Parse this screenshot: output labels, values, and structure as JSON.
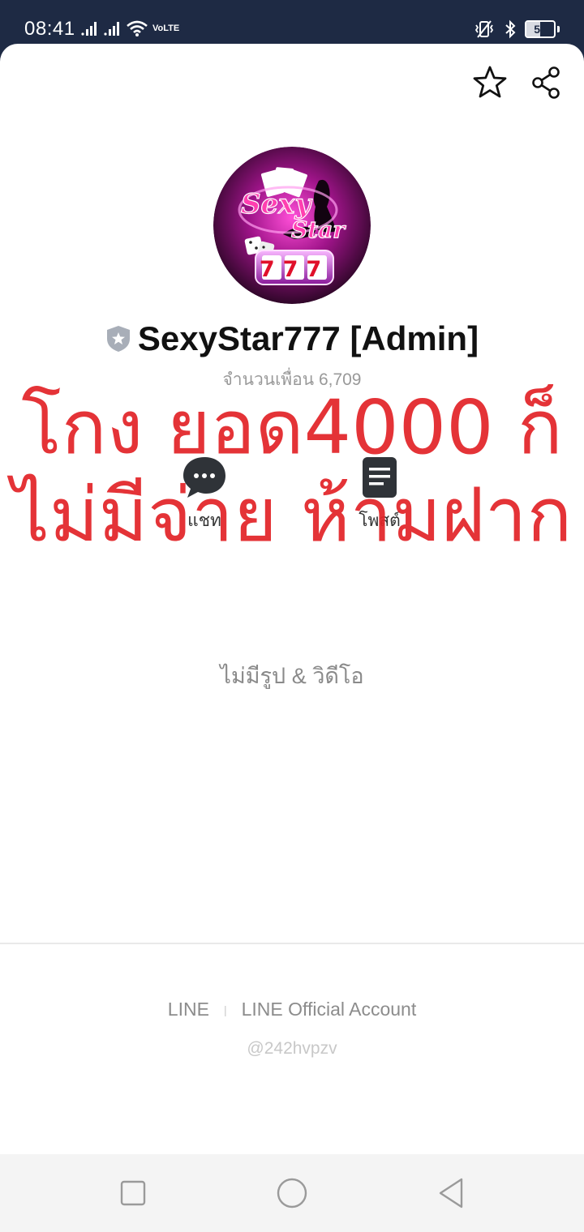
{
  "status_bar": {
    "time": "08:41",
    "network": "VoLTE",
    "battery": "51"
  },
  "header": {
    "favorite_icon": "star-outline-icon",
    "share_icon": "share-icon"
  },
  "profile": {
    "name": "SexyStar777 [Admin]",
    "friends_label": "จำนวนเพื่อน",
    "friends_count": "6,709",
    "badge_icon": "shield-star-icon"
  },
  "logo": {
    "line1": "Sexy",
    "line2": "Star",
    "number": "777"
  },
  "actions": [
    {
      "label": "แชท",
      "icon": "chat-bubble-icon"
    },
    {
      "label": "โพสต์",
      "icon": "post-list-icon"
    }
  ],
  "overlay": {
    "line1": "โกง ยอด4000  ก็",
    "line2": "ไม่มีจ่าย ห้ามฝาก",
    "color": "#e32428"
  },
  "media": {
    "empty_text": "ไม่มีรูป & วิดีโอ"
  },
  "footer": {
    "left": "LINE",
    "separator": "|",
    "right": "LINE Official Account",
    "id": "@242hvpzv"
  },
  "nav": {
    "recent_icon": "square-icon",
    "home_icon": "circle-icon",
    "back_icon": "triangle-back-icon"
  }
}
